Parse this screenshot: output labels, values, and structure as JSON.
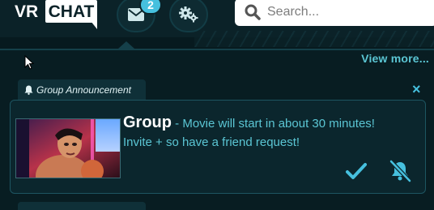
{
  "header": {
    "logo": {
      "left": "VR",
      "right": "CHAT"
    },
    "mail_badge_count": "2",
    "icons": {
      "mail": "envelope-icon",
      "settings": "gears-icon",
      "search": "search-icon"
    },
    "search_placeholder": "Search..."
  },
  "notifications": {
    "view_more_label": "View more...",
    "tab": {
      "icon": "bell-icon",
      "label": "Group Announcement"
    },
    "close_label": "×",
    "card": {
      "group_name": "Group",
      "separator": " - ",
      "message_line1": "Movie will start in about 30 minutes!",
      "message_line2": "Invite +  so have a friend request!",
      "actions": {
        "accept": "check-icon",
        "mute": "bell-slash-icon"
      }
    }
  },
  "colors": {
    "accent": "#5bc6d4",
    "background": "#071a1f",
    "badge": "#46c0de"
  }
}
